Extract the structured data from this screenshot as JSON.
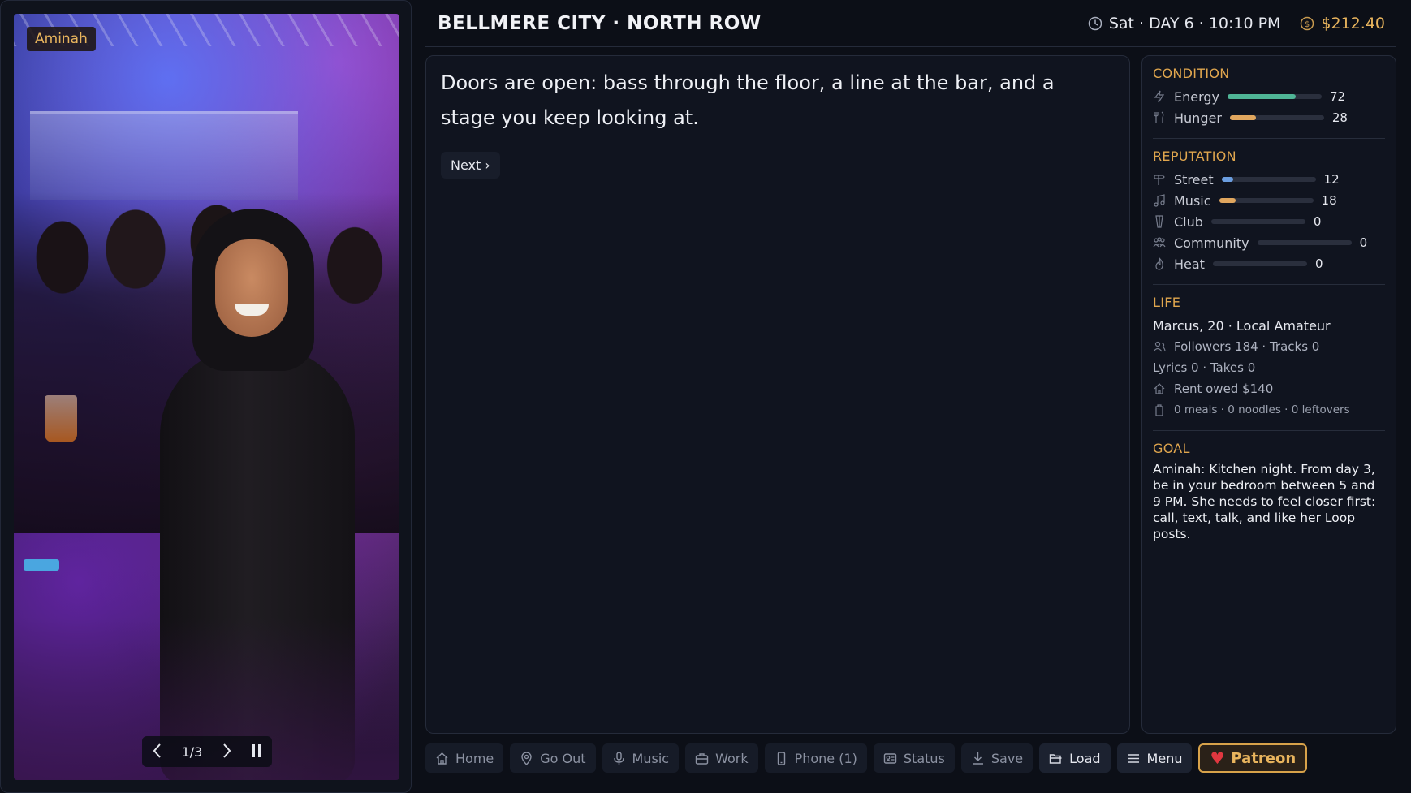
{
  "photo": {
    "name_tag": "Aminah",
    "pager": {
      "counter": "1/3"
    }
  },
  "header": {
    "title": "BELLMERE CITY · NORTH ROW",
    "time": "Sat · DAY 6 · 10:10 PM",
    "money": "$212.40"
  },
  "story": {
    "text": "Doors are open: bass through the floor, a line at the bar, and a stage you keep looking at.",
    "next_label": "Next ›"
  },
  "condition": {
    "title": "CONDITION",
    "items": [
      {
        "label": "Energy",
        "value": "72",
        "level": 0.72,
        "color": "#4fb596"
      },
      {
        "label": "Hunger",
        "value": "28",
        "level": 0.28,
        "color": "#e0a65e"
      }
    ]
  },
  "reputation": {
    "title": "REPUTATION",
    "items": [
      {
        "label": "Street",
        "value": "12",
        "level": 0.12,
        "color": "#6b9ee0"
      },
      {
        "label": "Music",
        "value": "18",
        "level": 0.18,
        "color": "#e0a65e"
      },
      {
        "label": "Club",
        "value": "0",
        "level": 0
      },
      {
        "label": "Community",
        "value": "0",
        "level": 0
      },
      {
        "label": "Heat",
        "value": "0",
        "level": 0
      }
    ]
  },
  "life": {
    "title": "LIFE",
    "identity": "Marcus, 20 · Local Amateur",
    "followers": "Followers 184 · Tracks 0",
    "lyrics": "Lyrics 0 · Takes 0",
    "rent": "Rent owed $140",
    "food": "0 meals · 0 noodles · 0 leftovers"
  },
  "goal": {
    "title": "GOAL",
    "text": "Aminah: Kitchen night. From day 3, be in your bedroom between 5 and 9 PM. She needs to feel closer first: call, text, talk, and like her Loop posts."
  },
  "bottombar": {
    "home": "Home",
    "go_out": "Go Out",
    "music": "Music",
    "work": "Work",
    "phone": "Phone (1)",
    "status": "Status",
    "save": "Save",
    "load": "Load",
    "menu": "Menu",
    "patreon": "Patreon"
  }
}
